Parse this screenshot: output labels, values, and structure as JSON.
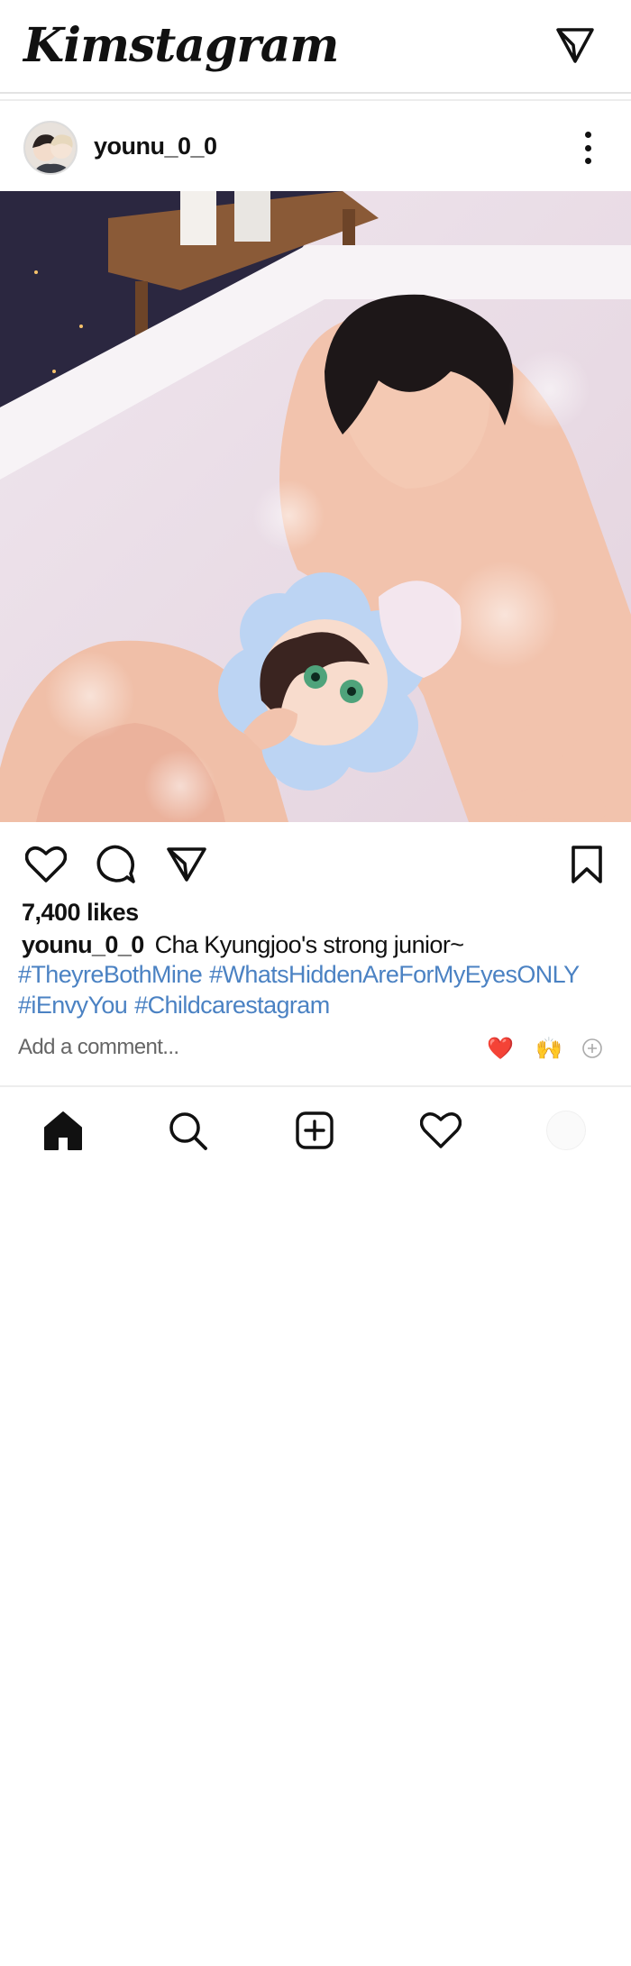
{
  "app": {
    "logo_text": "Kimstagram"
  },
  "post": {
    "username": "younu_0_0",
    "likes_text": "7,400 likes",
    "caption_user": "younu_0_0",
    "caption_text": "Cha Kyungjoo's strong junior~",
    "hashtags": [
      "#TheyreBothMine",
      "#WhatsHiddenAreForMyEyesONLY",
      "#iEnvyYou",
      "#Childcarestagram"
    ],
    "comment_placeholder": "Add a comment...",
    "quick_reactions": [
      "❤️",
      "🙌"
    ]
  },
  "icons": {
    "top_right": "send-icon",
    "post_menu": "more-vertical-icon",
    "actions": [
      "heart-icon",
      "comment-icon",
      "share-icon",
      "bookmark-icon"
    ],
    "bottom_nav": [
      "home-icon",
      "search-icon",
      "add-post-icon",
      "activity-heart-icon",
      "profile-avatar"
    ]
  },
  "colors": {
    "hashtag": "#4b82c3",
    "heart_reaction": "#e5202a",
    "text": "#111111"
  }
}
